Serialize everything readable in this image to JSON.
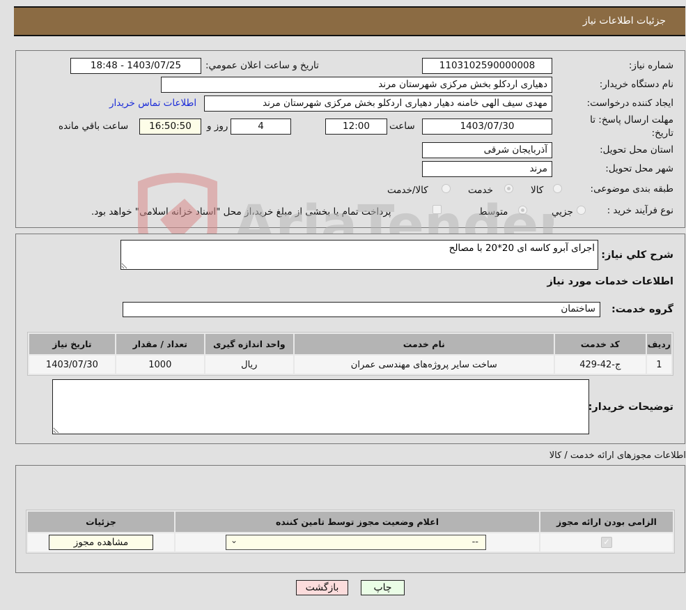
{
  "header": {
    "title": "جزئیات اطلاعات نیاز"
  },
  "form": {
    "need_number_label": "شماره نیاز:",
    "need_number": "1103102590000008",
    "announce_label": "تاریخ و ساعت اعلان عمومي:",
    "announce_value": "1403/07/25 - 18:48",
    "buyer_org_label": "نام دستگاه خریدار:",
    "buyer_org": "دهیاری اردکلو بخش مرکزی شهرستان مرند",
    "creator_label": "ایجاد کننده درخواست:",
    "creator": "مهدی سیف الهی خامنه دهیار دهیاری اردکلو بخش مرکزی شهرستان مرند",
    "contact_link": "اطلاعات تماس خریدار",
    "deadline_label": "مهلت ارسال پاسخ: تا تاریخ:",
    "deadline_date": "1403/07/30",
    "time_label": "ساعت",
    "deadline_time": "12:00",
    "days_value": "4",
    "days_label": "روز و",
    "remaining_time": "16:50:50",
    "remaining_label": "ساعت باقي مانده",
    "province_label": "استان محل تحویل:",
    "province": "آذربایجان شرقی",
    "city_label": "شهر محل تحویل:",
    "city": "مرند",
    "category_label": "طبقه بندی موضوعی:",
    "category_options": [
      {
        "label": "کالا",
        "selected": false
      },
      {
        "label": "خدمت",
        "selected": true
      },
      {
        "label": "کالا/خدمت",
        "selected": false
      }
    ],
    "process_label": "نوع فرآیند خرید :",
    "process_options": [
      {
        "label": "جزيي",
        "selected": false
      },
      {
        "label": "متوسط",
        "selected": true
      }
    ],
    "treasury_note": "پرداخت تمام یا بخشی از مبلغ خرید،از محل \"اسناد خزانه اسلامی\" خواهد بود."
  },
  "description": {
    "label": "شرح کلي نیاز:",
    "value": "اجرای آبرو کاسه ای 20*20 با مصالح"
  },
  "services": {
    "section_title": "اطلاعات خدمات مورد نیاز",
    "group_label": "گروه خدمت:",
    "group_value": "ساختمان",
    "columns": [
      "ردیف",
      "کد خدمت",
      "نام خدمت",
      "واحد اندازه گیری",
      "تعداد / مقدار",
      "تاریخ نیاز"
    ],
    "rows": [
      [
        "1",
        "ج-42-429",
        "ساخت سایر پروژه‌های مهندسی عمران",
        "ریال",
        "1000",
        "1403/07/30"
      ]
    ]
  },
  "buyer_notes": {
    "label": "توضیحات خریدار:",
    "value": ""
  },
  "permits": {
    "section_title": "اطلاعات مجوزهای ارائه خدمت / کالا",
    "columns": [
      "الزامی بودن ارائه مجوز",
      "اعلام وضعیت مجوز توسط تامین کننده",
      "جزئیات"
    ],
    "rows": [
      {
        "required": true,
        "status_selected": "--",
        "details_button": "مشاهده مجوز"
      }
    ]
  },
  "actions": {
    "print": "چاپ",
    "back": "بازگشت"
  },
  "watermark": {
    "text": "AriaTender.neT"
  }
}
